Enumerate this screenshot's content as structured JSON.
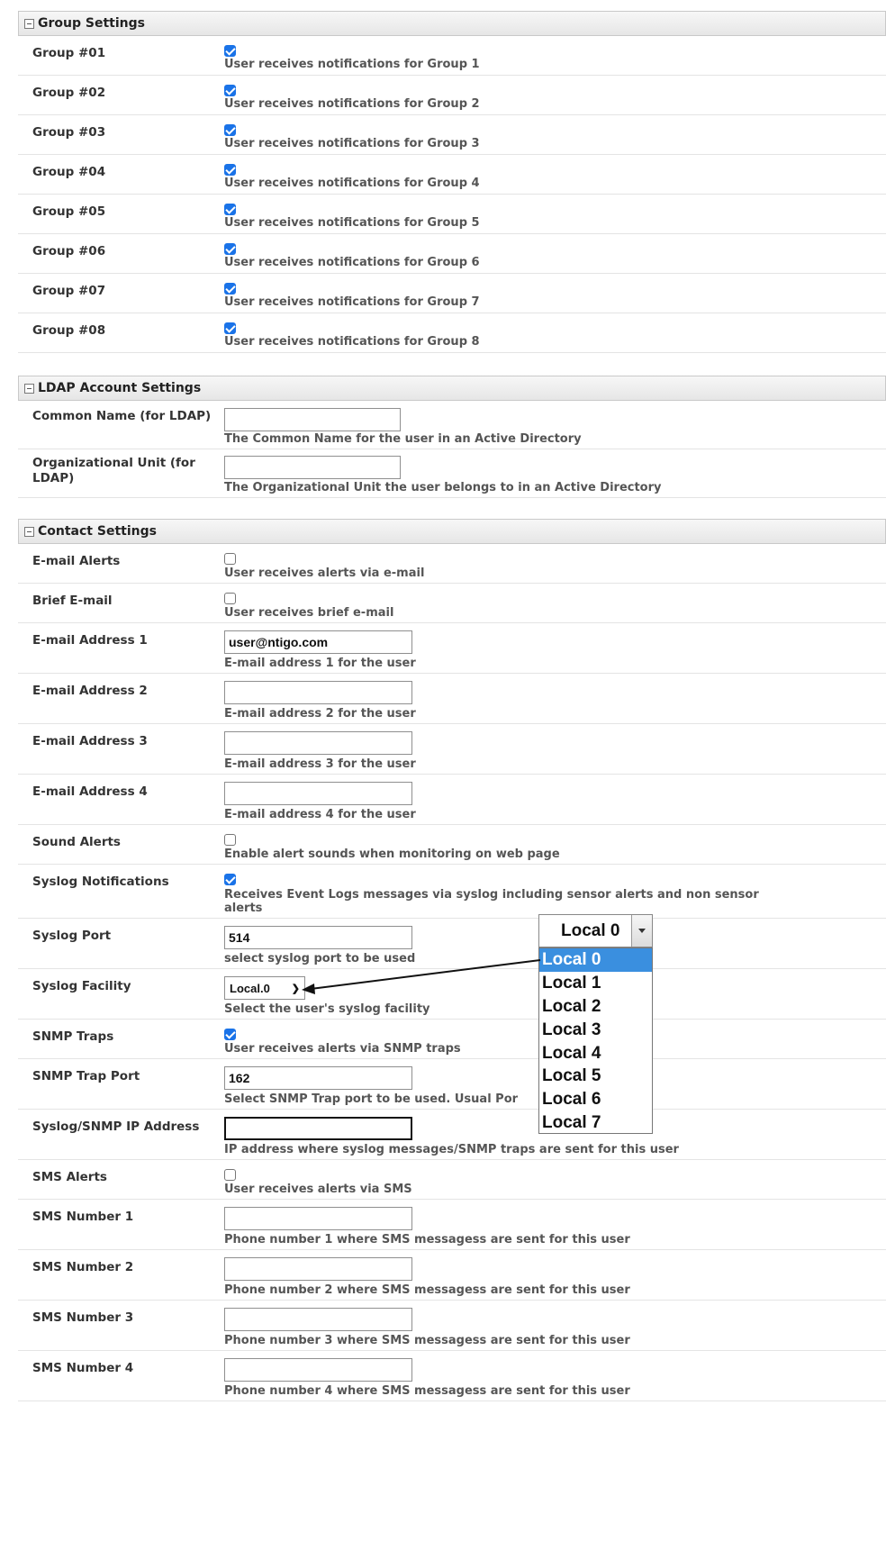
{
  "group_settings": {
    "title": "Group Settings",
    "rows": [
      {
        "label": "Group #01",
        "checked": true,
        "desc": "User receives notifications for Group 1"
      },
      {
        "label": "Group #02",
        "checked": true,
        "desc": "User receives notifications for Group 2"
      },
      {
        "label": "Group #03",
        "checked": true,
        "desc": "User receives notifications for Group 3"
      },
      {
        "label": "Group #04",
        "checked": true,
        "desc": "User receives notifications for Group 4"
      },
      {
        "label": "Group #05",
        "checked": true,
        "desc": "User receives notifications for Group 5"
      },
      {
        "label": "Group #06",
        "checked": true,
        "desc": "User receives notifications for Group 6"
      },
      {
        "label": "Group #07",
        "checked": true,
        "desc": "User receives notifications for Group 7"
      },
      {
        "label": "Group #08",
        "checked": true,
        "desc": "User receives notifications for Group 8"
      }
    ]
  },
  "ldap_settings": {
    "title": "LDAP Account Settings",
    "common_name": {
      "label": "Common Name (for LDAP)",
      "value": "",
      "desc": "The Common Name for the user in an Active Directory"
    },
    "org_unit": {
      "label": "Organizational Unit (for LDAP)",
      "value": "",
      "desc": "The Organizational Unit the user belongs to in an Active Directory"
    }
  },
  "contact_settings": {
    "title": "Contact Settings",
    "email_alerts": {
      "label": "E-mail Alerts",
      "checked": false,
      "desc": "User receives alerts via e-mail"
    },
    "brief_email": {
      "label": "Brief E-mail",
      "checked": false,
      "desc": "User receives brief e-mail"
    },
    "email1": {
      "label": "E-mail Address 1",
      "value": "user@ntigo.com",
      "desc": "E-mail address 1 for the user"
    },
    "email2": {
      "label": "E-mail Address 2",
      "value": "",
      "desc": "E-mail address 2 for the user"
    },
    "email3": {
      "label": "E-mail Address 3",
      "value": "",
      "desc": "E-mail address 3 for the user"
    },
    "email4": {
      "label": "E-mail Address 4",
      "value": "",
      "desc": "E-mail address 4 for the user"
    },
    "sound_alerts": {
      "label": "Sound Alerts",
      "checked": false,
      "desc": "Enable alert sounds when monitoring on web page"
    },
    "syslog_notifications": {
      "label": "Syslog Notifications",
      "checked": true,
      "desc_line1": "Receives Event Logs messages via syslog including sensor alerts and non sensor",
      "desc_line2": "alerts"
    },
    "syslog_port": {
      "label": "Syslog Port",
      "value": "514",
      "desc": "select syslog port to be used"
    },
    "syslog_facility": {
      "label": "Syslog Facility",
      "value": "Local.0",
      "desc": "Select the user's syslog facility"
    },
    "snmp_traps": {
      "label": "SNMP Traps",
      "checked": true,
      "desc": "User receives alerts via SNMP traps"
    },
    "snmp_trap_port": {
      "label": "SNMP Trap Port",
      "value": "162",
      "desc": "Select SNMP Trap port to be used. Usual Por"
    },
    "ip_address": {
      "label": "Syslog/SNMP IP Address",
      "value": "",
      "desc": "IP address where syslog messages/SNMP traps are sent for this user"
    },
    "sms_alerts": {
      "label": "SMS Alerts",
      "checked": false,
      "desc": "User receives alerts via SMS"
    },
    "sms1": {
      "label": "SMS Number 1",
      "value": "",
      "desc": "Phone number 1 where SMS messagess are sent for this user"
    },
    "sms2": {
      "label": "SMS Number 2",
      "value": "",
      "desc": "Phone number 2 where SMS messagess are sent for this user"
    },
    "sms3": {
      "label": "SMS Number 3",
      "value": "",
      "desc": "Phone number 3 where SMS messagess are sent for this user"
    },
    "sms4": {
      "label": "SMS Number 4",
      "value": "",
      "desc": "Phone number 4 where SMS messagess are sent for this user"
    }
  },
  "facility_dropdown": {
    "selected": "Local 0",
    "options": [
      "Local 0",
      "Local 1",
      "Local 2",
      "Local 3",
      "Local 4",
      "Local 5",
      "Local 6",
      "Local 7"
    ],
    "highlighted": "Local 0"
  }
}
